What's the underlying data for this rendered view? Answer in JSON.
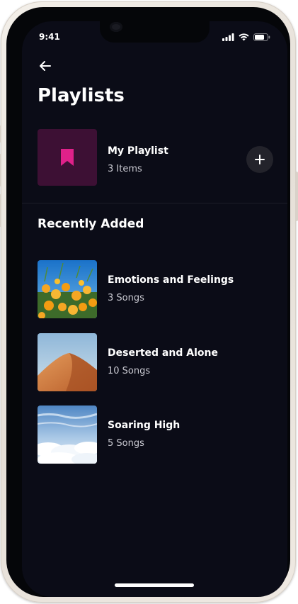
{
  "status_bar": {
    "time": "9:41"
  },
  "header": {
    "back_icon": "arrow-left-icon",
    "title": "Playlists"
  },
  "my_playlist": {
    "name": "My Playlist",
    "count": "3 Items",
    "icon": "bookmark-icon",
    "tile_color": "#3d1034",
    "icon_color": "#e0218a"
  },
  "section": {
    "title": "Recently Added"
  },
  "songs": [
    {
      "title": "Emotions and Feelings",
      "subtitle": "3 Songs",
      "image": "orange-flowers-sky"
    },
    {
      "title": "Deserted and Alone",
      "subtitle": "10 Songs",
      "image": "desert-dune"
    },
    {
      "title": "Soaring High",
      "subtitle": "5 Songs",
      "image": "clouds-sky"
    }
  ],
  "theme": {
    "background": "#0b0c17",
    "text_primary": "#ffffff",
    "text_secondary": "#c9c9d1"
  }
}
